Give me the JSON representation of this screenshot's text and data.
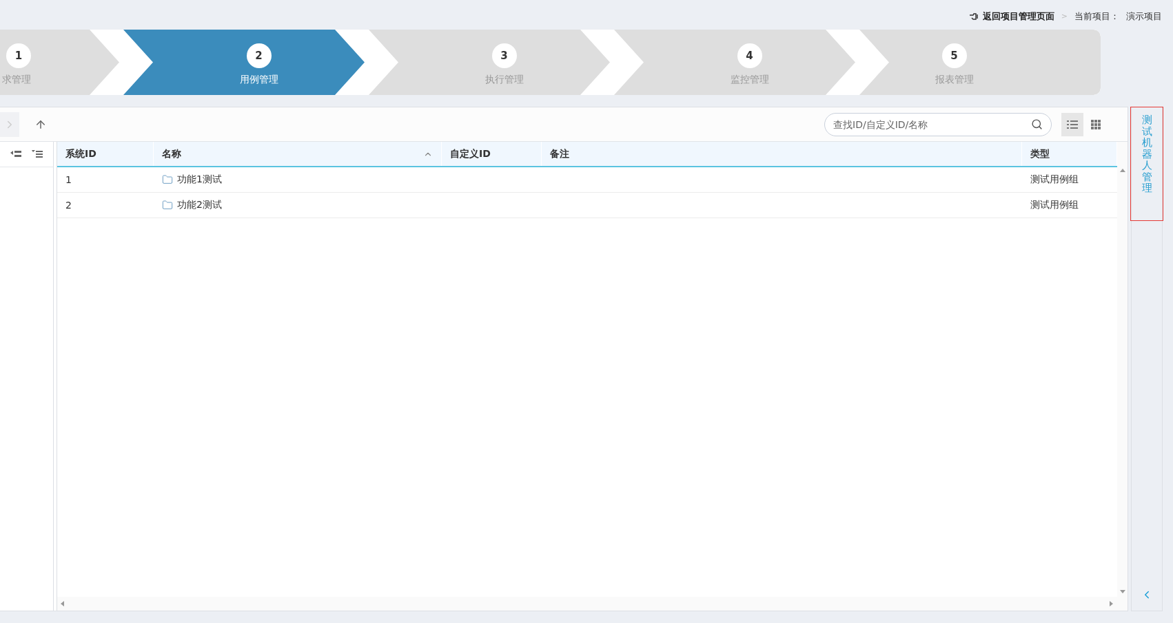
{
  "header": {
    "back_link": "返回项目管理页面",
    "separator": ">",
    "project_label": "当前项目：",
    "project_name": "演示项目"
  },
  "steps": [
    {
      "number": "1",
      "label": "求管理",
      "selected": false
    },
    {
      "number": "2",
      "label": "用例管理",
      "selected": true
    },
    {
      "number": "3",
      "label": "执行管理",
      "selected": false
    },
    {
      "number": "4",
      "label": "监控管理",
      "selected": false
    },
    {
      "number": "5",
      "label": "报表管理",
      "selected": false
    }
  ],
  "toolbar": {
    "search": {
      "placeholder": "查找ID/自定义ID/名称"
    },
    "views": [
      {
        "kind": "list",
        "selected": true
      },
      {
        "kind": "grid",
        "selected": false
      }
    ]
  },
  "table": {
    "columns": [
      {
        "label": "系统ID",
        "sorted": false
      },
      {
        "label": "名称",
        "sorted": true
      },
      {
        "label": "自定义ID",
        "sorted": false
      },
      {
        "label": "备注",
        "sorted": false
      },
      {
        "label": "类型",
        "sorted": false
      }
    ],
    "rows": [
      {
        "system_id": "1",
        "name": "功能1测试",
        "type": "测试用例组"
      },
      {
        "system_id": "2",
        "name": "功能2测试",
        "type": "测试用例组"
      }
    ]
  },
  "side_panel": {
    "title": "测试机器人管理"
  }
}
